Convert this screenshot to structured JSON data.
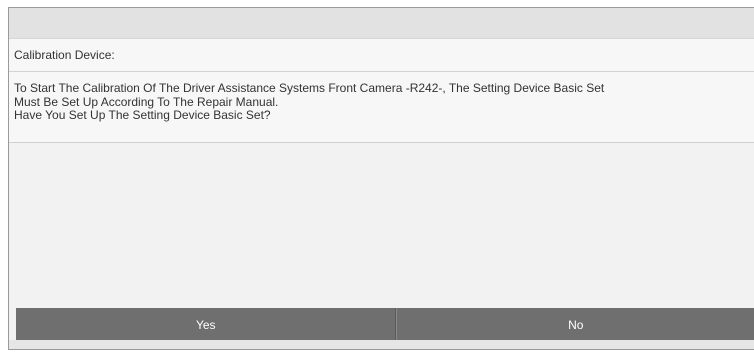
{
  "dialog": {
    "device_label": "Calibration Device:",
    "message_lines": [
      "To Start The Calibration Of The Driver Assistance Systems Front Camera -R242-, The Setting Device Basic Set",
      "Must Be Set Up According To The Repair Manual.",
      "Have You Set Up The Setting Device Basic Set?"
    ]
  },
  "buttons": {
    "yes_label": "Yes",
    "no_label": "No"
  },
  "colors": {
    "button_bg": "#6f6f6f",
    "title_bar_bg": "#e2e2e2",
    "panel_bg": "#f2f2f2"
  }
}
